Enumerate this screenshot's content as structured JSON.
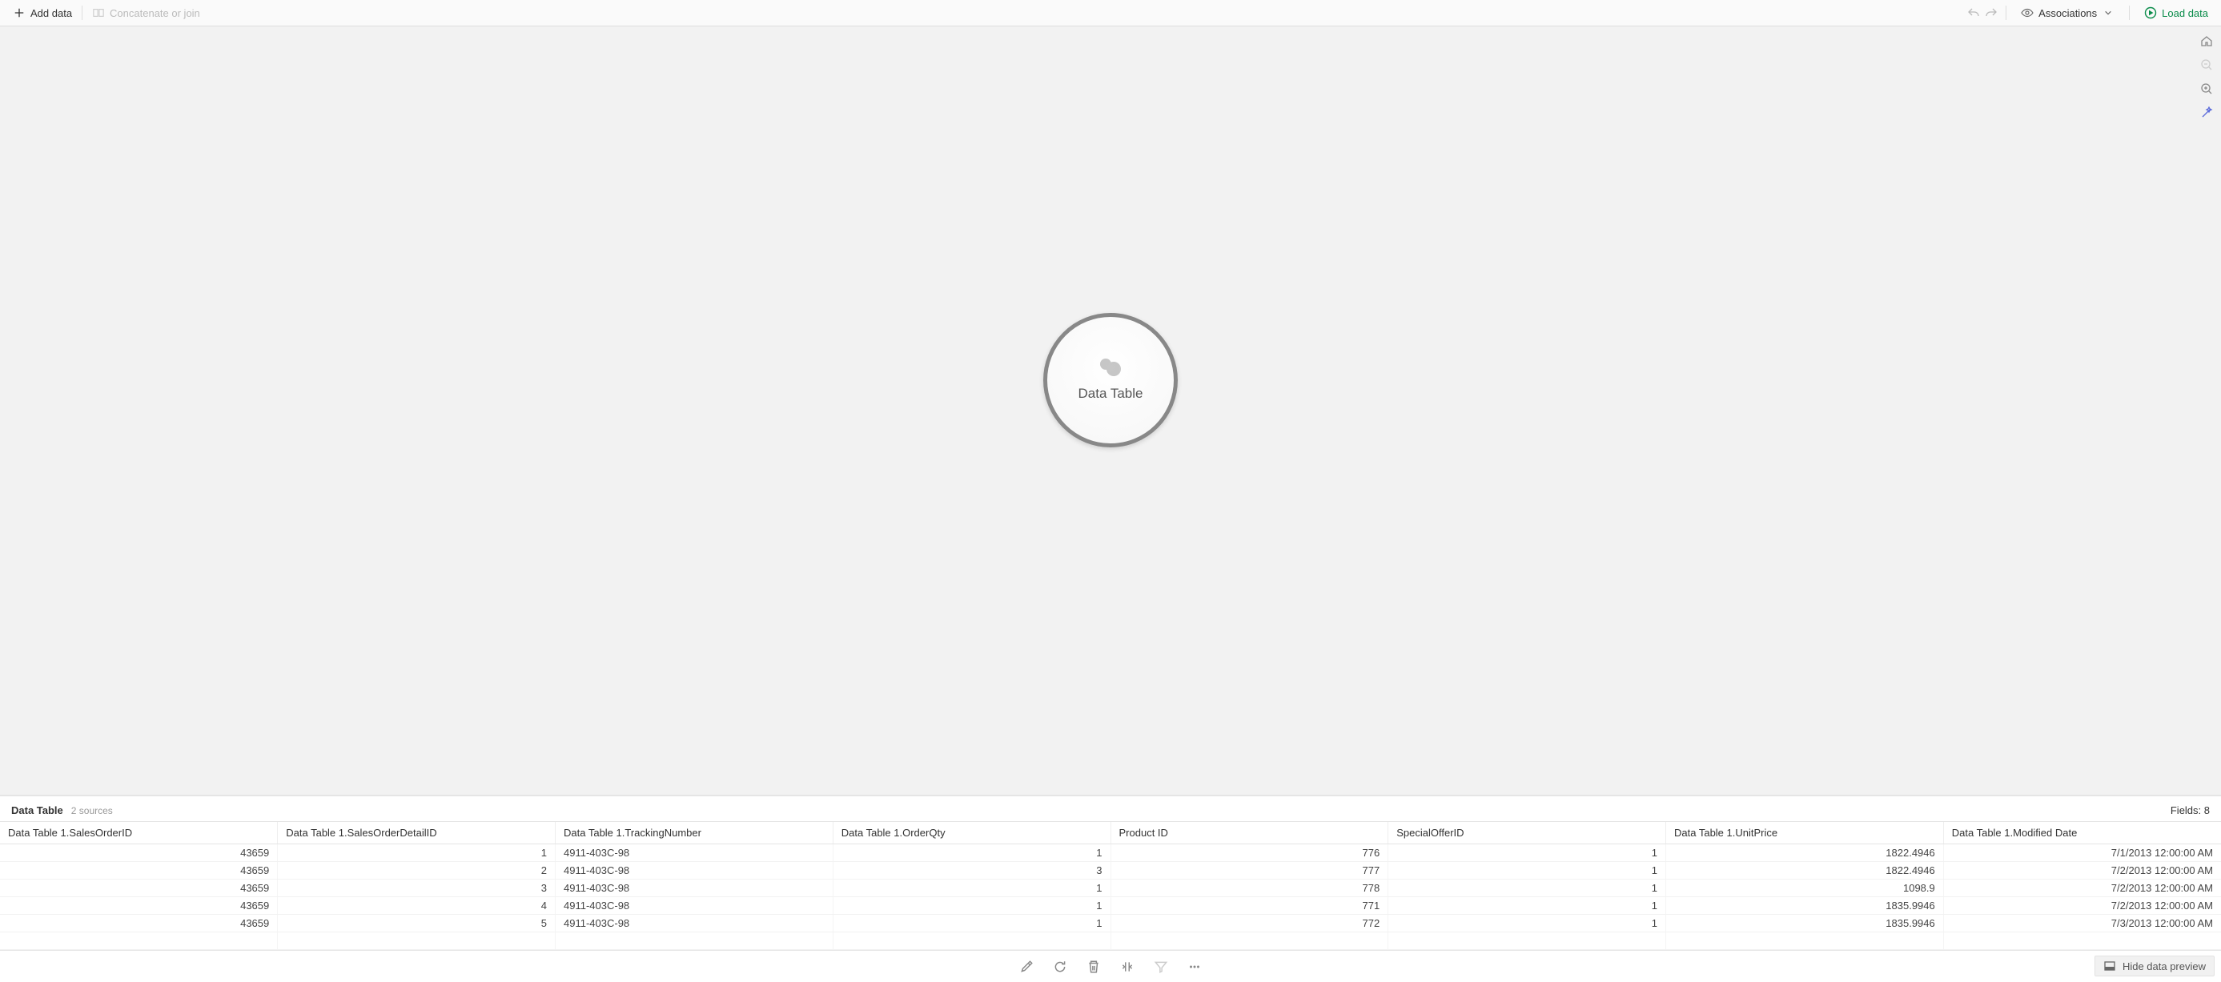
{
  "toolbar": {
    "add_data": "Add data",
    "concat_join": "Concatenate or join",
    "associations": "Associations",
    "load_data": "Load data"
  },
  "bubble": {
    "label": "Data Table"
  },
  "preview": {
    "title": "Data Table",
    "sources": "2 sources",
    "fields_label": "Fields: 8",
    "columns": [
      "Data Table 1.SalesOrderID",
      "Data Table 1.SalesOrderDetailID",
      "Data Table 1.TrackingNumber",
      "Data Table 1.OrderQty",
      "Product ID",
      "SpecialOfferID",
      "Data Table 1.UnitPrice",
      "Data Table 1.Modified Date"
    ],
    "align": [
      "num",
      "num",
      "txt",
      "num",
      "num",
      "num",
      "num",
      "num"
    ],
    "rows": [
      [
        "43659",
        "1",
        "4911-403C-98",
        "1",
        "776",
        "1",
        "1822.4946",
        "7/1/2013 12:00:00 AM"
      ],
      [
        "43659",
        "2",
        "4911-403C-98",
        "3",
        "777",
        "1",
        "1822.4946",
        "7/2/2013 12:00:00 AM"
      ],
      [
        "43659",
        "3",
        "4911-403C-98",
        "1",
        "778",
        "1",
        "1098.9",
        "7/2/2013 12:00:00 AM"
      ],
      [
        "43659",
        "4",
        "4911-403C-98",
        "1",
        "771",
        "1",
        "1835.9946",
        "7/2/2013 12:00:00 AM"
      ],
      [
        "43659",
        "5",
        "4911-403C-98",
        "1",
        "772",
        "1",
        "1835.9946",
        "7/3/2013 12:00:00 AM"
      ]
    ]
  },
  "footer": {
    "hide_preview": "Hide data preview"
  }
}
